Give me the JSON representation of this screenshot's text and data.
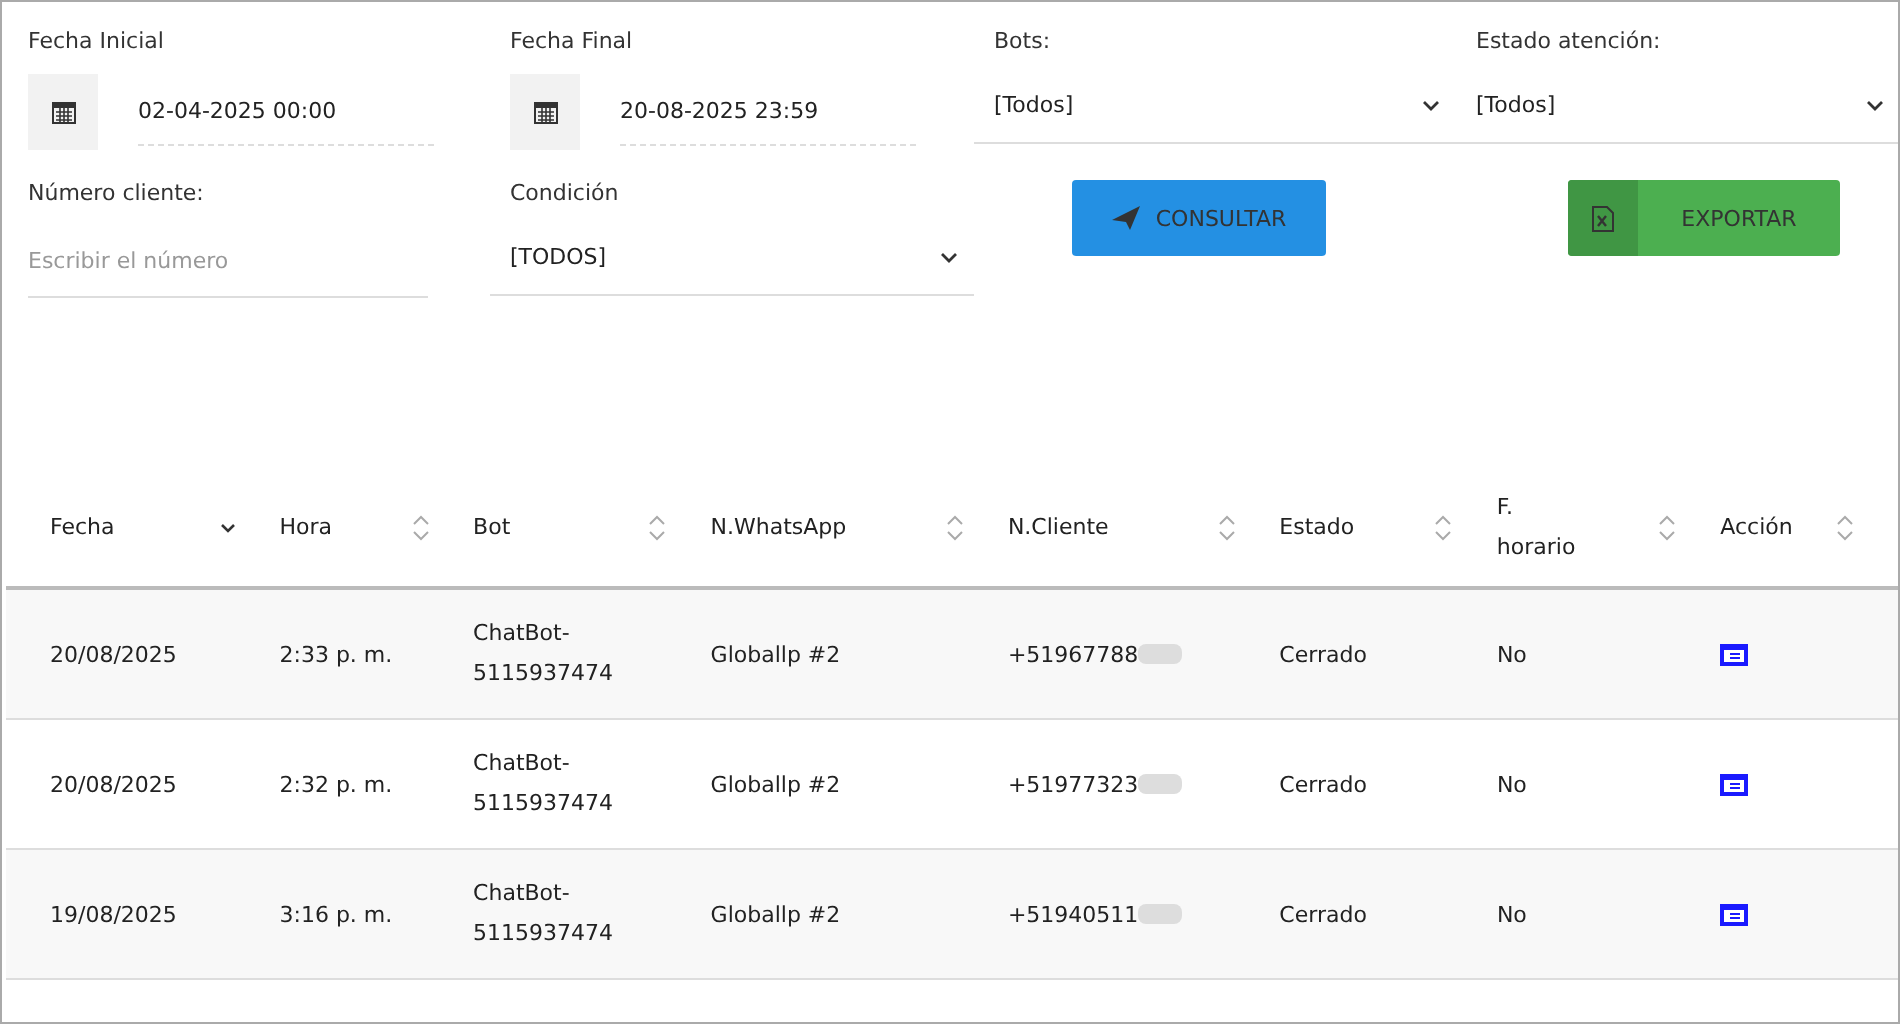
{
  "filters": {
    "fecha_inicial": {
      "label": "Fecha Inicial",
      "value": "02-04-2025 00:00"
    },
    "fecha_final": {
      "label": "Fecha Final",
      "value": "20-08-2025 23:59"
    },
    "bots": {
      "label": "Bots:",
      "value": "[Todos]"
    },
    "estado_atencion": {
      "label": "Estado atención:",
      "value": "[Todos]"
    },
    "numero_cliente": {
      "label": "Número cliente:",
      "placeholder": "Escribir el número"
    },
    "condicion": {
      "label": "Condición",
      "value": "[TODOS]"
    }
  },
  "buttons": {
    "consultar": "CONSULTAR",
    "exportar": "EXPORTAR"
  },
  "table": {
    "columns": [
      {
        "label": "Fecha",
        "sorted": true
      },
      {
        "label": "Hora",
        "sorted": false
      },
      {
        "label": "Bot",
        "sorted": false
      },
      {
        "label": "N.WhatsApp",
        "sorted": false
      },
      {
        "label": "N.Cliente",
        "sorted": false
      },
      {
        "label": "Estado",
        "sorted": false
      },
      {
        "label": "F. horario",
        "sorted": false
      },
      {
        "label": "Acción",
        "sorted": false
      }
    ],
    "rows": [
      {
        "fecha": "20/08/2025",
        "hora": "2:33 p. m.",
        "bot": "ChatBot-5115937474",
        "whatsapp": "Globallp #2",
        "cliente": "+51967788",
        "estado": "Cerrado",
        "f_horario": "No"
      },
      {
        "fecha": "20/08/2025",
        "hora": "2:32 p. m.",
        "bot": "ChatBot-5115937474",
        "whatsapp": "Globallp #2",
        "cliente": "+51977323",
        "estado": "Cerrado",
        "f_horario": "No"
      },
      {
        "fecha": "19/08/2025",
        "hora": "3:16 p. m.",
        "bot": "ChatBot-5115937474",
        "whatsapp": "Globallp #2",
        "cliente": "+51940511",
        "estado": "Cerrado",
        "f_horario": "No"
      }
    ]
  }
}
